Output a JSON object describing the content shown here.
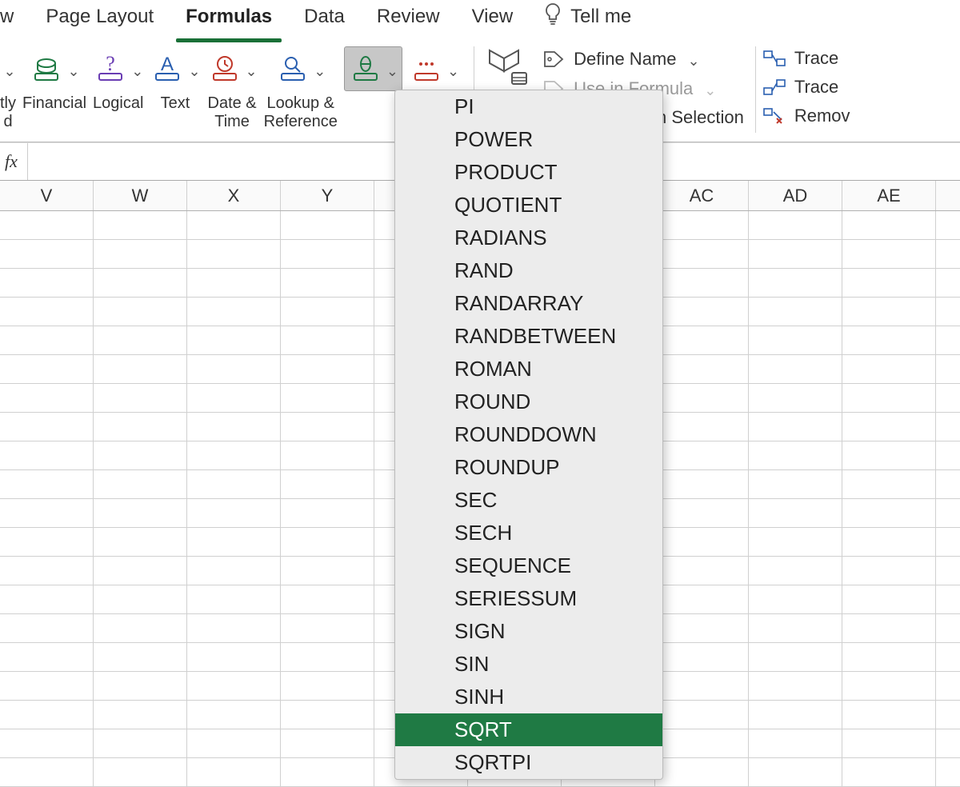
{
  "ribbon": {
    "tabs": [
      {
        "label": "w",
        "partial": true
      },
      {
        "label": "Page Layout"
      },
      {
        "label": "Formulas",
        "active": true
      },
      {
        "label": "Data"
      },
      {
        "label": "Review"
      },
      {
        "label": "View"
      }
    ],
    "tellme": "Tell me"
  },
  "toolbar": {
    "insert_partial": "tly",
    "insert_partial2": "d",
    "financial": "Financial",
    "logical": "Logical",
    "text": "Text",
    "datetime": "Date &\nTime",
    "lookup": "Lookup &\nReference"
  },
  "defined_names": {
    "define_name": "Define Name",
    "use_in_formula": "Use in Formula",
    "create_from_selection": "Create from Selection"
  },
  "trace": {
    "trace_precedents": "Trace",
    "trace_dependents": "Trace",
    "remove": "Remov"
  },
  "formula_bar": {
    "fx": "fx",
    "value": ""
  },
  "columns": [
    "V",
    "W",
    "X",
    "Y",
    "",
    "",
    "",
    "AC",
    "AD",
    "AE",
    ""
  ],
  "row_count": 20,
  "dropdown": {
    "items": [
      "PI",
      "POWER",
      "PRODUCT",
      "QUOTIENT",
      "RADIANS",
      "RAND",
      "RANDARRAY",
      "RANDBETWEEN",
      "ROMAN",
      "ROUND",
      "ROUNDDOWN",
      "ROUNDUP",
      "SEC",
      "SECH",
      "SEQUENCE",
      "SERIESSUM",
      "SIGN",
      "SIN",
      "SINH",
      "SQRT",
      "SQRTPI"
    ],
    "selected": "SQRT"
  }
}
